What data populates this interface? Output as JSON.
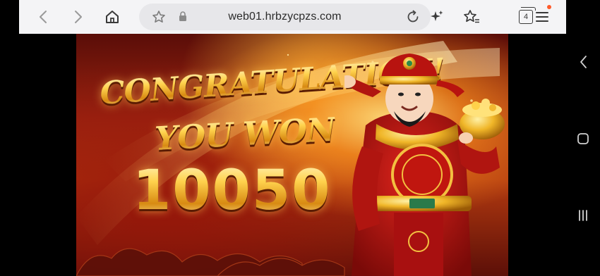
{
  "browser": {
    "url": "web01.hrbzycpzs.com",
    "tab_count": "4"
  },
  "game": {
    "headline": "CONGRATULATION!",
    "subline": "YOU WON",
    "amount": "10050"
  },
  "colors": {
    "toolbar_bg": "#f4f4f6",
    "urlbar_bg": "#e7e7ea",
    "notification_dot": "#ff5a2a",
    "gold": "#ffd35a",
    "deep_red": "#9a2410"
  },
  "icons": {
    "back": "chevron-left-icon",
    "forward": "chevron-right-icon",
    "home": "home-icon",
    "bookmark": "star-icon",
    "lock": "lock-icon",
    "reload": "reload-icon",
    "ai": "sparkle-icon",
    "favorites": "star-list-icon",
    "tabs": "tabs-icon",
    "menu": "menu-icon",
    "sys_back": "chevron-left-icon",
    "sys_home": "square-icon",
    "sys_recents": "recents-icon"
  }
}
